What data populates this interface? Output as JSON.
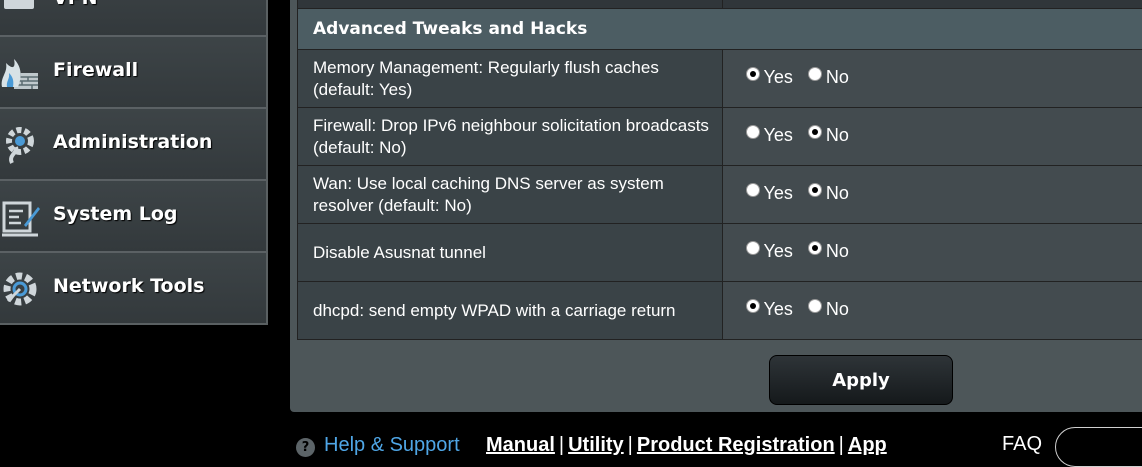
{
  "sidebar": {
    "items": [
      {
        "label": "VPN",
        "icon": "vpn-icon"
      },
      {
        "label": "Firewall",
        "icon": "firewall-icon"
      },
      {
        "label": "Administration",
        "icon": "administration-icon"
      },
      {
        "label": "System Log",
        "icon": "system-log-icon"
      },
      {
        "label": "Network Tools",
        "icon": "network-tools-icon"
      }
    ]
  },
  "section": {
    "title": "Advanced Tweaks and Hacks",
    "yes_label": "Yes",
    "no_label": "No",
    "rows": [
      {
        "desc": "Memory Management: Regularly flush caches (default: Yes)",
        "selected": "Yes"
      },
      {
        "desc": "Firewall: Drop IPv6 neighbour solicitation broadcasts (default: No)",
        "selected": "No"
      },
      {
        "desc": "Wan: Use local caching DNS server as system resolver (default: No)",
        "selected": "No"
      },
      {
        "desc": "Disable Asusnat tunnel",
        "selected": "No"
      },
      {
        "desc": "dhcpd: send empty WPAD with a carriage return",
        "selected": "Yes"
      }
    ]
  },
  "apply_label": "Apply",
  "footer": {
    "help": "Help & Support",
    "links": [
      "Manual",
      "Utility",
      "Product Registration",
      "App"
    ],
    "separator": "|",
    "faq": "FAQ"
  },
  "colors": {
    "panel": "#4d5659",
    "section_header": "#4c5d63",
    "help_link": "#4fa6e6"
  }
}
